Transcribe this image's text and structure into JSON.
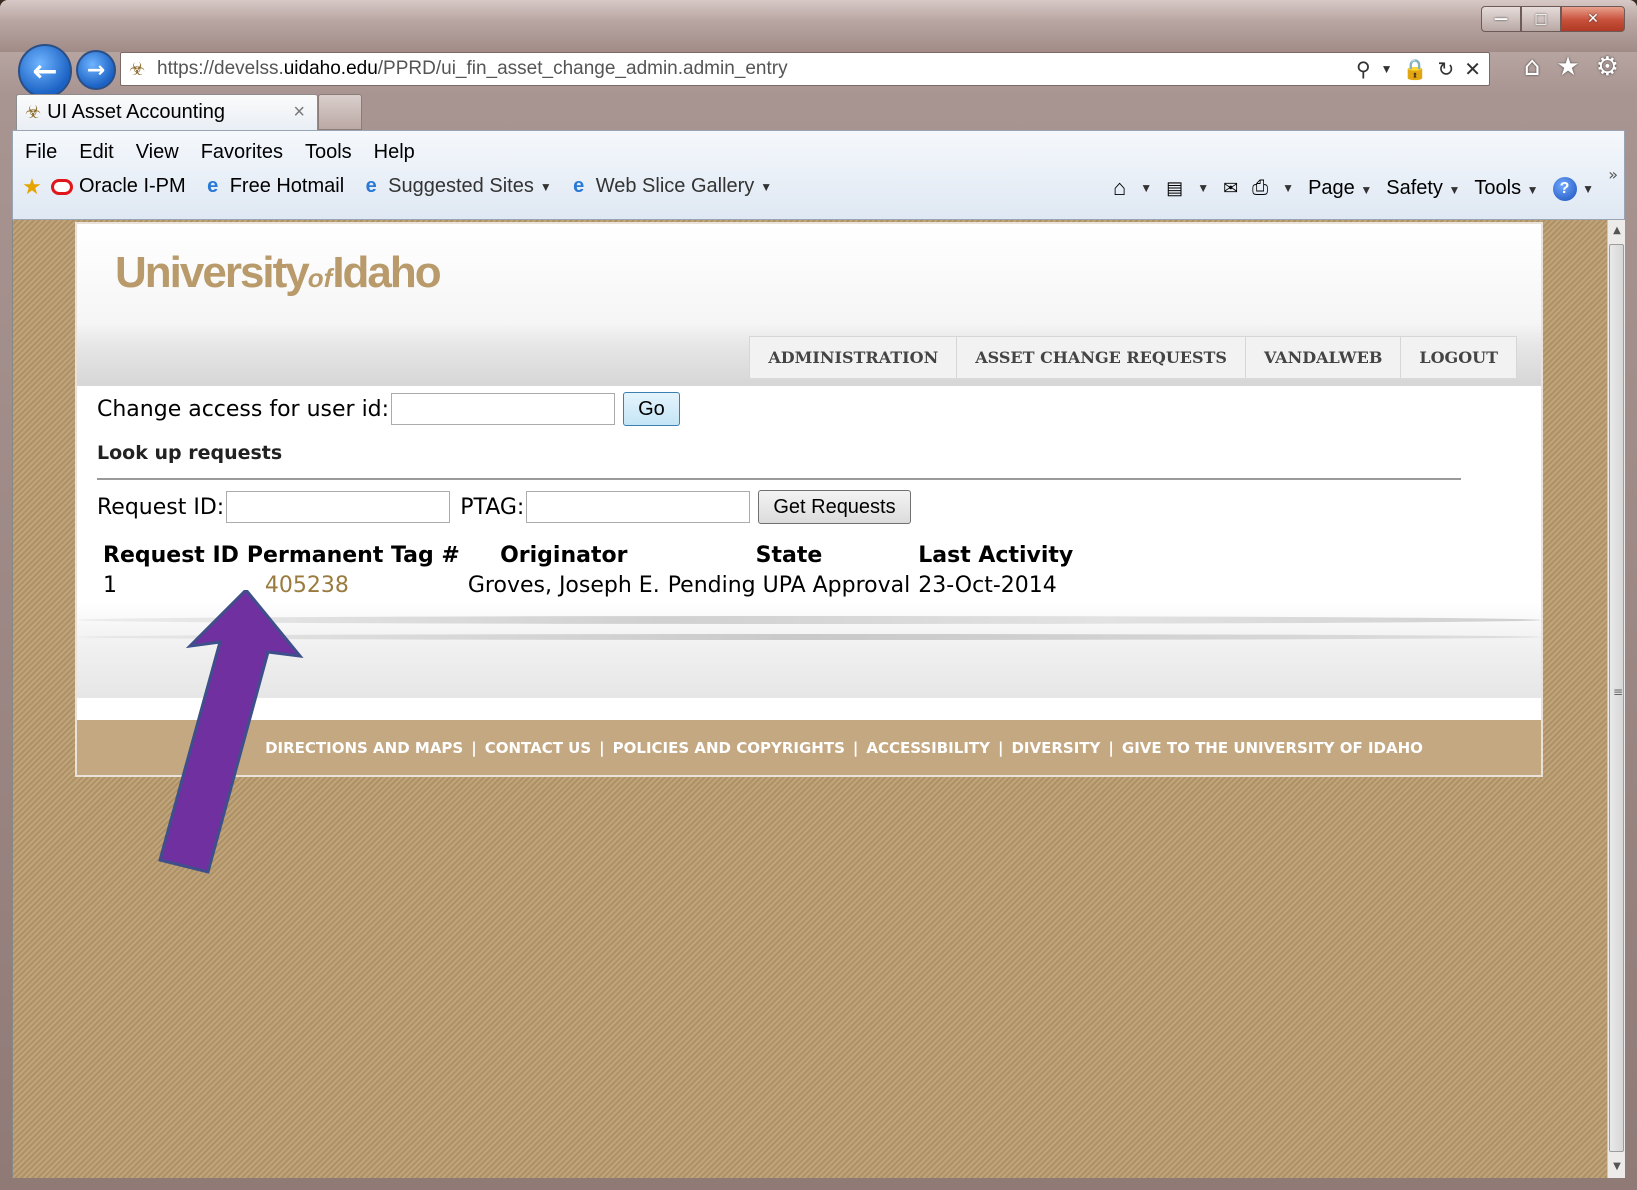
{
  "browser": {
    "url_scheme": "https://",
    "url_pre": "develss.",
    "url_domain": "uidaho.edu",
    "url_path": "/PPRD/ui_fin_asset_change_admin.admin_entry",
    "tab_title": "UI Asset Accounting",
    "menu": [
      "File",
      "Edit",
      "View",
      "Favorites",
      "Tools",
      "Help"
    ],
    "favorites": [
      "Oracle I-PM",
      "Free Hotmail",
      "Suggested Sites",
      "Web Slice Gallery"
    ],
    "commands": [
      "Page",
      "Safety",
      "Tools"
    ]
  },
  "site": {
    "logo_university": "University",
    "logo_of": "of",
    "logo_idaho": "Idaho",
    "nav": [
      "ADMINISTRATION",
      "ASSET CHANGE REQUESTS",
      "VANDALWEB",
      "LOGOUT"
    ]
  },
  "form": {
    "change_access_label": "Change access for user id:",
    "change_access_value": "",
    "go_label": "Go",
    "lookup_title": "Look up requests",
    "request_id_label": "Request ID:",
    "request_id_value": "",
    "ptag_label": "PTAG:",
    "ptag_value": "",
    "get_requests_label": "Get Requests"
  },
  "results": {
    "headers": [
      "Request ID",
      "Permanent Tag #",
      "Originator",
      "State",
      "Last Activity"
    ],
    "rows": [
      [
        "1",
        "405238",
        "Groves, Joseph E.",
        "Pending UPA Approval",
        "23-Oct-2014"
      ]
    ]
  },
  "footer": {
    "links": [
      "DIRECTIONS AND MAPS",
      "CONTACT US",
      "POLICIES AND COPYRIGHTS",
      "ACCESSIBILITY",
      "DIVERSITY",
      "GIVE TO THE UNIVERSITY OF IDAHO"
    ]
  },
  "colors": {
    "accent_gold": "#b99b6b",
    "link_gold": "#9b7b3d",
    "footer_tan": "#c4a882",
    "arrow_purple": "#7030a0"
  }
}
